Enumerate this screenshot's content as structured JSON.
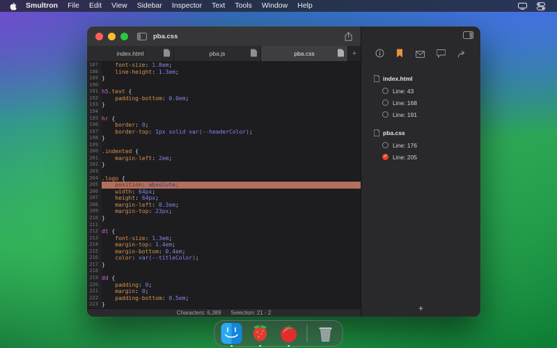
{
  "menu_bar": {
    "items": [
      "Smultron",
      "File",
      "Edit",
      "View",
      "Sidebar",
      "Inspector",
      "Text",
      "Tools",
      "Window",
      "Help"
    ]
  },
  "window": {
    "title": "pba.css",
    "tabs": [
      {
        "label": "index.html"
      },
      {
        "label": "pba.js"
      },
      {
        "label": "pba.css"
      }
    ],
    "active_tab": "pba.css",
    "new_tab_label": "+",
    "status": {
      "characters": "Characters: 6,389",
      "selection": "Selection: 21 - 2"
    }
  },
  "editor": {
    "first_line": 187,
    "last_line": 223,
    "highlighted_line": 205,
    "colors": {
      "property": "#d9924f",
      "value": "#8484ee",
      "selector": "#cf6bcf",
      "class_selector": "#d9924f",
      "punctuation": "#d4d4d6",
      "highlight_bg": "#b2705e"
    },
    "lines": [
      {
        "n": 187,
        "tk": [
          [
            "pr",
            "    font-size"
          ],
          [
            "pu",
            ": "
          ],
          [
            "va",
            "1.8em"
          ],
          [
            "pu",
            ";"
          ]
        ]
      },
      {
        "n": 188,
        "tk": [
          [
            "pr",
            "    line-height"
          ],
          [
            "pu",
            ": "
          ],
          [
            "va",
            "1.3em"
          ],
          [
            "pu",
            ";"
          ]
        ]
      },
      {
        "n": 189,
        "tk": [
          [
            "pu",
            "}"
          ]
        ]
      },
      {
        "n": 190,
        "tk": []
      },
      {
        "n": 191,
        "tk": [
          [
            "se",
            "h5"
          ],
          [
            "cl",
            ".text"
          ],
          [
            "pu",
            " {"
          ]
        ]
      },
      {
        "n": 192,
        "tk": [
          [
            "pr",
            "    padding-bottom"
          ],
          [
            "pu",
            ": "
          ],
          [
            "va",
            "0.0em"
          ],
          [
            "pu",
            ";"
          ]
        ]
      },
      {
        "n": 193,
        "tk": [
          [
            "pu",
            "}"
          ]
        ]
      },
      {
        "n": 194,
        "tk": []
      },
      {
        "n": 195,
        "tk": [
          [
            "se",
            "hr"
          ],
          [
            "pu",
            " {"
          ]
        ]
      },
      {
        "n": 196,
        "tk": [
          [
            "pr",
            "    border"
          ],
          [
            "pu",
            ": "
          ],
          [
            "va",
            "0"
          ],
          [
            "pu",
            ";"
          ]
        ]
      },
      {
        "n": 197,
        "tk": [
          [
            "pr",
            "    border-top"
          ],
          [
            "pu",
            ": "
          ],
          [
            "va",
            "1px solid var(--headerColor)"
          ],
          [
            "pu",
            ";"
          ]
        ]
      },
      {
        "n": 198,
        "tk": [
          [
            "pu",
            "}"
          ]
        ]
      },
      {
        "n": 199,
        "tk": []
      },
      {
        "n": 200,
        "tk": [
          [
            "cl",
            ".indented"
          ],
          [
            "pu",
            " {"
          ]
        ]
      },
      {
        "n": 201,
        "tk": [
          [
            "pr",
            "    margin-left"
          ],
          [
            "pu",
            ": "
          ],
          [
            "va",
            "2em"
          ],
          [
            "pu",
            ";"
          ]
        ]
      },
      {
        "n": 202,
        "tk": [
          [
            "pu",
            "}"
          ]
        ]
      },
      {
        "n": 203,
        "tk": []
      },
      {
        "n": 204,
        "tk": [
          [
            "cl",
            ".logo"
          ],
          [
            "pu",
            " {"
          ]
        ]
      },
      {
        "n": 205,
        "tk": [
          [
            "pr",
            "    position"
          ],
          [
            "pu",
            ": "
          ],
          [
            "va",
            "absolute"
          ],
          [
            "pu",
            ";"
          ]
        ]
      },
      {
        "n": 206,
        "tk": [
          [
            "pr",
            "    width"
          ],
          [
            "pu",
            ": "
          ],
          [
            "va",
            "64px"
          ],
          [
            "pu",
            ";"
          ]
        ]
      },
      {
        "n": 207,
        "tk": [
          [
            "pr",
            "    height"
          ],
          [
            "pu",
            ": "
          ],
          [
            "va",
            "64px"
          ],
          [
            "pu",
            ";"
          ]
        ]
      },
      {
        "n": 208,
        "tk": [
          [
            "pr",
            "    margin-left"
          ],
          [
            "pu",
            ": "
          ],
          [
            "va",
            "0.3em"
          ],
          [
            "pu",
            ";"
          ]
        ]
      },
      {
        "n": 209,
        "tk": [
          [
            "pr",
            "    margin-top"
          ],
          [
            "pu",
            ": "
          ],
          [
            "va",
            "23px"
          ],
          [
            "pu",
            ";"
          ]
        ]
      },
      {
        "n": 210,
        "tk": [
          [
            "pu",
            "}"
          ]
        ]
      },
      {
        "n": 211,
        "tk": []
      },
      {
        "n": 212,
        "tk": [
          [
            "se",
            "dt"
          ],
          [
            "pu",
            " {"
          ]
        ]
      },
      {
        "n": 213,
        "tk": [
          [
            "pr",
            "    font-size"
          ],
          [
            "pu",
            ": "
          ],
          [
            "va",
            "1.3em"
          ],
          [
            "pu",
            ";"
          ]
        ]
      },
      {
        "n": 214,
        "tk": [
          [
            "pr",
            "    margin-top"
          ],
          [
            "pu",
            ": "
          ],
          [
            "va",
            "1.4em"
          ],
          [
            "pu",
            ";"
          ]
        ]
      },
      {
        "n": 215,
        "tk": [
          [
            "pr",
            "    margin-bottom"
          ],
          [
            "pu",
            ": "
          ],
          [
            "va",
            "0.4em"
          ],
          [
            "pu",
            ";"
          ]
        ]
      },
      {
        "n": 216,
        "tk": [
          [
            "pr",
            "    color"
          ],
          [
            "pu",
            ": "
          ],
          [
            "va",
            "var(--titleColor)"
          ],
          [
            "pu",
            ";"
          ]
        ]
      },
      {
        "n": 217,
        "tk": [
          [
            "pu",
            "}"
          ]
        ]
      },
      {
        "n": 218,
        "tk": []
      },
      {
        "n": 219,
        "tk": [
          [
            "se",
            "dd"
          ],
          [
            "pu",
            " {"
          ]
        ]
      },
      {
        "n": 220,
        "tk": [
          [
            "pr",
            "    padding"
          ],
          [
            "pu",
            ": "
          ],
          [
            "va",
            "0"
          ],
          [
            "pu",
            ";"
          ]
        ]
      },
      {
        "n": 221,
        "tk": [
          [
            "pr",
            "    margin"
          ],
          [
            "pu",
            ": "
          ],
          [
            "va",
            "0"
          ],
          [
            "pu",
            ";"
          ]
        ]
      },
      {
        "n": 222,
        "tk": [
          [
            "pr",
            "    padding-bottom"
          ],
          [
            "pu",
            ": "
          ],
          [
            "va",
            "0.5em"
          ],
          [
            "pu",
            ";"
          ]
        ]
      },
      {
        "n": 223,
        "tk": [
          [
            "pu",
            "}"
          ]
        ]
      }
    ]
  },
  "inspector": {
    "toolbar_icons": [
      "info-icon",
      "bookmark-icon",
      "envelope-icon",
      "comment-icon",
      "share-arrow-icon"
    ],
    "active_tool": "bookmark-icon",
    "accent": "#e8923f",
    "checked_color": "#e8452e",
    "sections": [
      {
        "file": "index.html",
        "items": [
          {
            "label": "Line: 43",
            "checked": false
          },
          {
            "label": "Line: 168",
            "checked": false
          },
          {
            "label": "Line: 191",
            "checked": false
          }
        ]
      },
      {
        "file": "pba.css",
        "items": [
          {
            "label": "Line: 176",
            "checked": false
          },
          {
            "label": "Line: 205",
            "checked": true
          }
        ]
      }
    ],
    "add_label": "+",
    "check_glyph": "✓"
  },
  "dock": {
    "items": [
      "finder",
      "smultron",
      "tomato",
      "trash"
    ],
    "running": [
      "finder",
      "smultron",
      "tomato"
    ]
  }
}
